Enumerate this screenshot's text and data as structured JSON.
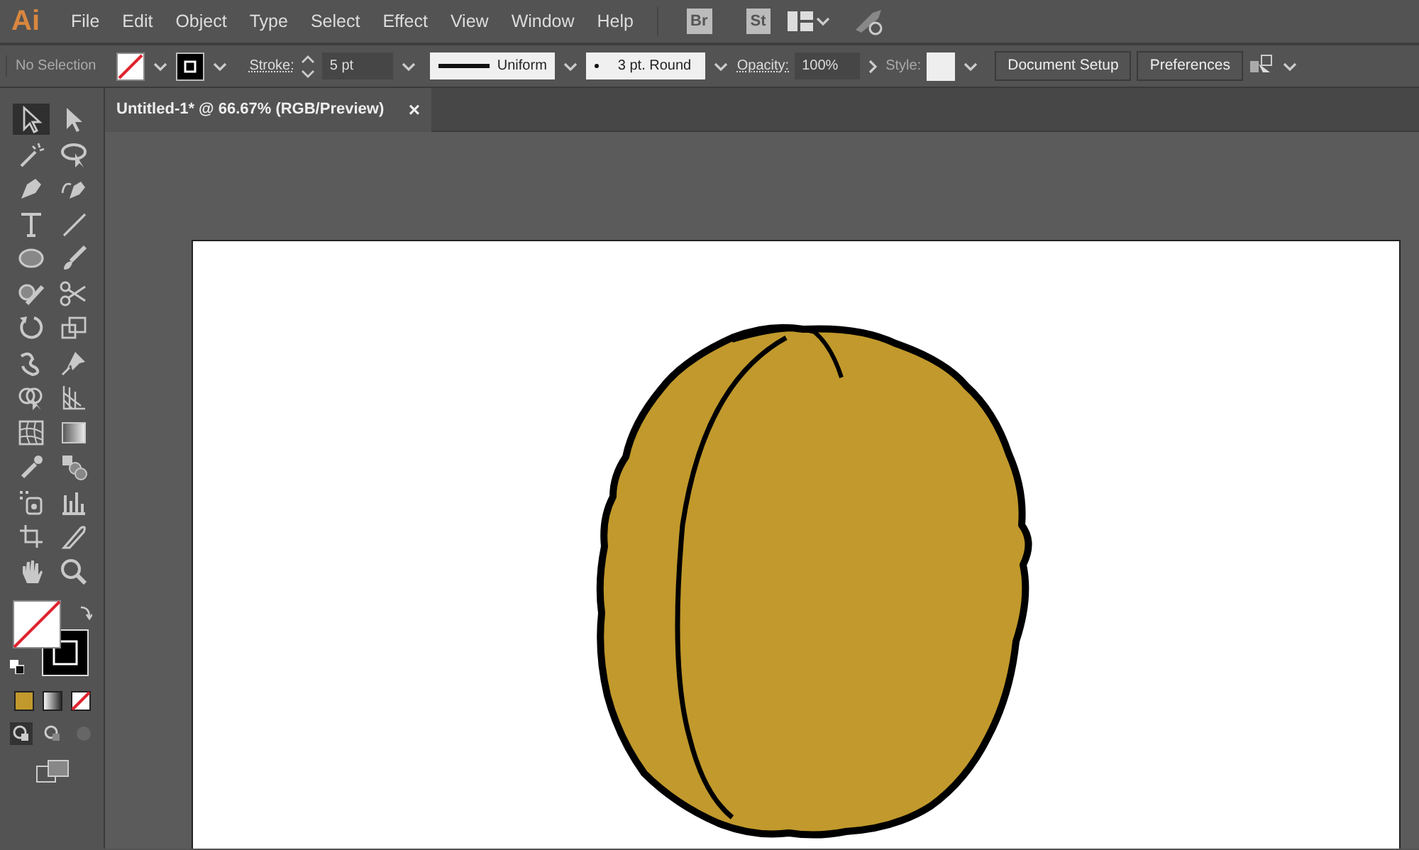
{
  "app_logo": "Ai",
  "menu": [
    "File",
    "Edit",
    "Object",
    "Type",
    "Select",
    "Effect",
    "View",
    "Window",
    "Help"
  ],
  "menu_badges": [
    "Br",
    "St"
  ],
  "control_bar": {
    "selection_label": "No Selection",
    "fill_none": true,
    "stroke_label": "Stroke:",
    "stroke_weight": "5 pt",
    "profile": "Uniform",
    "brush": "3 pt. Round",
    "opacity_label": "Opacity:",
    "opacity": "100%",
    "style_label": "Style:",
    "buttons": [
      "Document Setup",
      "Preferences"
    ]
  },
  "document_tab": {
    "title": "Untitled-1* @ 66.67% (RGB/Preview)",
    "close": "×"
  },
  "tools": [
    {
      "kind": "selection",
      "selected": true
    },
    {
      "kind": "direct",
      "selected": false
    },
    {
      "kind": "wand",
      "selected": false
    },
    {
      "kind": "lasso",
      "selected": false
    },
    {
      "kind": "pen",
      "selected": false
    },
    {
      "kind": "curvature",
      "selected": false
    },
    {
      "kind": "type",
      "selected": false
    },
    {
      "kind": "line",
      "selected": false
    },
    {
      "kind": "ellipse",
      "selected": false
    },
    {
      "kind": "brush",
      "selected": false
    },
    {
      "kind": "shaper",
      "selected": false
    },
    {
      "kind": "scissors",
      "selected": false
    },
    {
      "kind": "rotate",
      "selected": false
    },
    {
      "kind": "scale",
      "selected": false
    },
    {
      "kind": "warp",
      "selected": false
    },
    {
      "kind": "pin",
      "selected": false
    },
    {
      "kind": "builder",
      "selected": false
    },
    {
      "kind": "perspective",
      "selected": false
    },
    {
      "kind": "mesh",
      "selected": false
    },
    {
      "kind": "gradient",
      "selected": false
    },
    {
      "kind": "eyedropper",
      "selected": false
    },
    {
      "kind": "blend",
      "selected": false
    },
    {
      "kind": "sprayer",
      "selected": false
    },
    {
      "kind": "graph",
      "selected": false
    },
    {
      "kind": "artboard",
      "selected": false
    },
    {
      "kind": "knife",
      "selected": false
    },
    {
      "kind": "hand",
      "selected": false
    },
    {
      "kind": "zoom",
      "selected": false
    }
  ],
  "color_modes": [
    {
      "kind": "color",
      "color": "#c1992c"
    },
    {
      "kind": "gradient"
    },
    {
      "kind": "none"
    }
  ]
}
